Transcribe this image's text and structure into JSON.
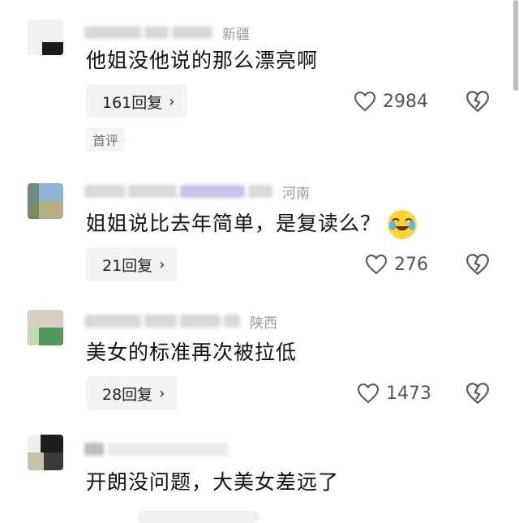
{
  "colors": {
    "bg": "#ffffff",
    "pill": "#f3f3f3",
    "text": "#111111",
    "muted": "#9a9a9a"
  },
  "comments": [
    {
      "region": "新疆",
      "text": "他姐没他说的那么漂亮啊",
      "reply_label": "161回复",
      "likes": "2984",
      "tag": "首评"
    },
    {
      "region": "河南",
      "text": "姐姐说比去年简单，是复读么？",
      "reply_label": "21回复",
      "likes": "276"
    },
    {
      "region": "陕西",
      "text": "美女的标准再次被拉低",
      "reply_label": "28回复",
      "likes": "1473"
    },
    {
      "text": "开朗没问题，大美女差远了"
    }
  ],
  "icons": {
    "like": "heart-outline-icon",
    "dislike": "broken-heart-icon",
    "chevron": "chevron-right-icon",
    "emoji": "crying-laughing-emoji"
  }
}
